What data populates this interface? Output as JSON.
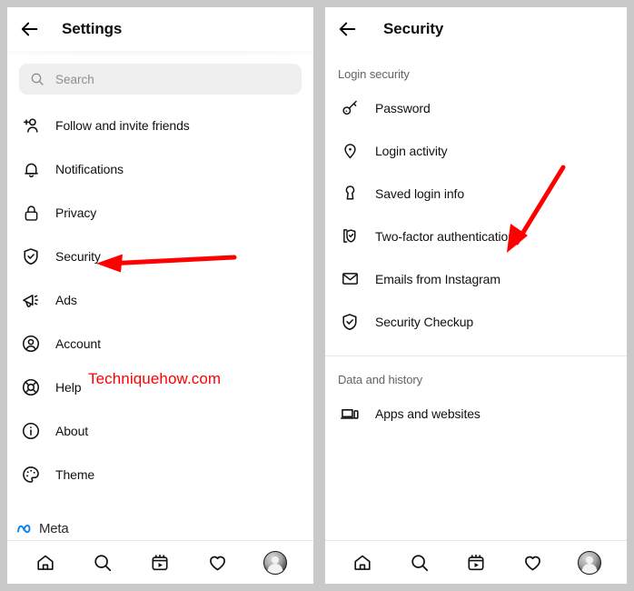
{
  "screen": {
    "background_color": "#c9c9c9",
    "watermark": "Techniquehow.com",
    "watermark_color": "#ff0000",
    "annotation_arrow_color": "#ff0000"
  },
  "left_panel": {
    "header": {
      "title": "Settings",
      "back_icon": "arrow-left-icon"
    },
    "search": {
      "placeholder": "Search",
      "icon": "search-icon",
      "value": ""
    },
    "items": [
      {
        "label": "Follow and invite friends",
        "icon": "person-add-icon"
      },
      {
        "label": "Notifications",
        "icon": "bell-icon"
      },
      {
        "label": "Privacy",
        "icon": "lock-icon"
      },
      {
        "label": "Security",
        "icon": "shield-check-icon"
      },
      {
        "label": "Ads",
        "icon": "megaphone-icon"
      },
      {
        "label": "Account",
        "icon": "account-circle-icon"
      },
      {
        "label": "Help",
        "icon": "lifebuoy-icon"
      },
      {
        "label": "About",
        "icon": "info-circle-icon"
      },
      {
        "label": "Theme",
        "icon": "palette-icon"
      }
    ],
    "footer": {
      "brand": "Meta",
      "brand_icon": "meta-infinity-icon",
      "brand_color": "#0081fb"
    },
    "navbar": [
      {
        "name": "home",
        "icon": "home-icon"
      },
      {
        "name": "search",
        "icon": "search-icon"
      },
      {
        "name": "reels",
        "icon": "reels-icon"
      },
      {
        "name": "activity",
        "icon": "heart-icon"
      },
      {
        "name": "profile",
        "icon": "avatar-icon"
      }
    ]
  },
  "right_panel": {
    "header": {
      "title": "Security",
      "back_icon": "arrow-left-icon"
    },
    "sections": [
      {
        "title": "Login security",
        "items": [
          {
            "label": "Password",
            "icon": "key-icon"
          },
          {
            "label": "Login activity",
            "icon": "location-pin-icon"
          },
          {
            "label": "Saved login info",
            "icon": "keyhole-icon"
          },
          {
            "label": "Two-factor authentication",
            "icon": "two-factor-icon"
          },
          {
            "label": "Emails from Instagram",
            "icon": "envelope-icon"
          },
          {
            "label": "Security Checkup",
            "icon": "shield-check-icon"
          }
        ]
      },
      {
        "title": "Data and history",
        "items": [
          {
            "label": "Apps and websites",
            "icon": "laptop-phone-icon"
          }
        ]
      }
    ],
    "navbar": [
      {
        "name": "home",
        "icon": "home-icon"
      },
      {
        "name": "search",
        "icon": "search-icon"
      },
      {
        "name": "reels",
        "icon": "reels-icon"
      },
      {
        "name": "activity",
        "icon": "heart-icon"
      },
      {
        "name": "profile",
        "icon": "avatar-icon"
      }
    ]
  }
}
